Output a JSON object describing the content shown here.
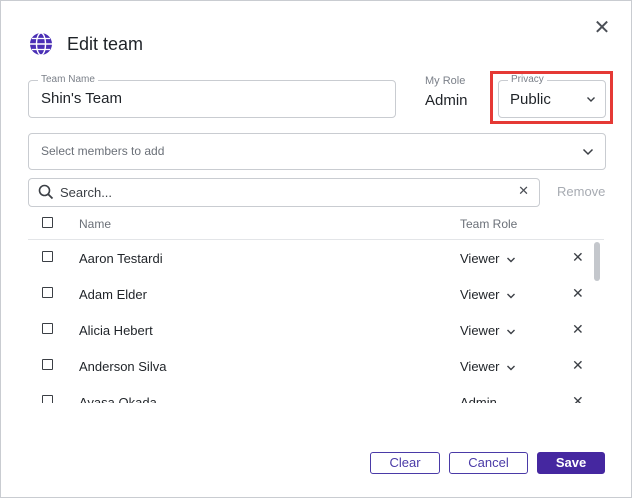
{
  "dialog": {
    "title": "Edit team",
    "icon": "globe-icon",
    "close_icon": "close-icon"
  },
  "form": {
    "team_name_label": "Team Name",
    "team_name_value": "Shin's Team",
    "my_role_label": "My Role",
    "my_role_value": "Admin",
    "privacy_label": "Privacy",
    "privacy_value": "Public",
    "members_placeholder": "Select members to add"
  },
  "search": {
    "placeholder": "Search...",
    "clear_icon": "clear-icon",
    "remove_label": "Remove"
  },
  "table": {
    "columns": [
      "Name",
      "Team Role"
    ],
    "rows": [
      {
        "name": "Aaron Testardi",
        "role": "Viewer"
      },
      {
        "name": "Adam Elder",
        "role": "Viewer"
      },
      {
        "name": "Alicia Hebert",
        "role": "Viewer"
      },
      {
        "name": "Anderson Silva",
        "role": "Viewer"
      },
      {
        "name": "Ayasa Okada",
        "role": "Admin"
      }
    ]
  },
  "footer": {
    "clear_label": "Clear",
    "cancel_label": "Cancel",
    "save_label": "Save"
  },
  "colors": {
    "accent": "#4527a0",
    "highlight": "#e53935",
    "globe": "#4a2fb5"
  }
}
